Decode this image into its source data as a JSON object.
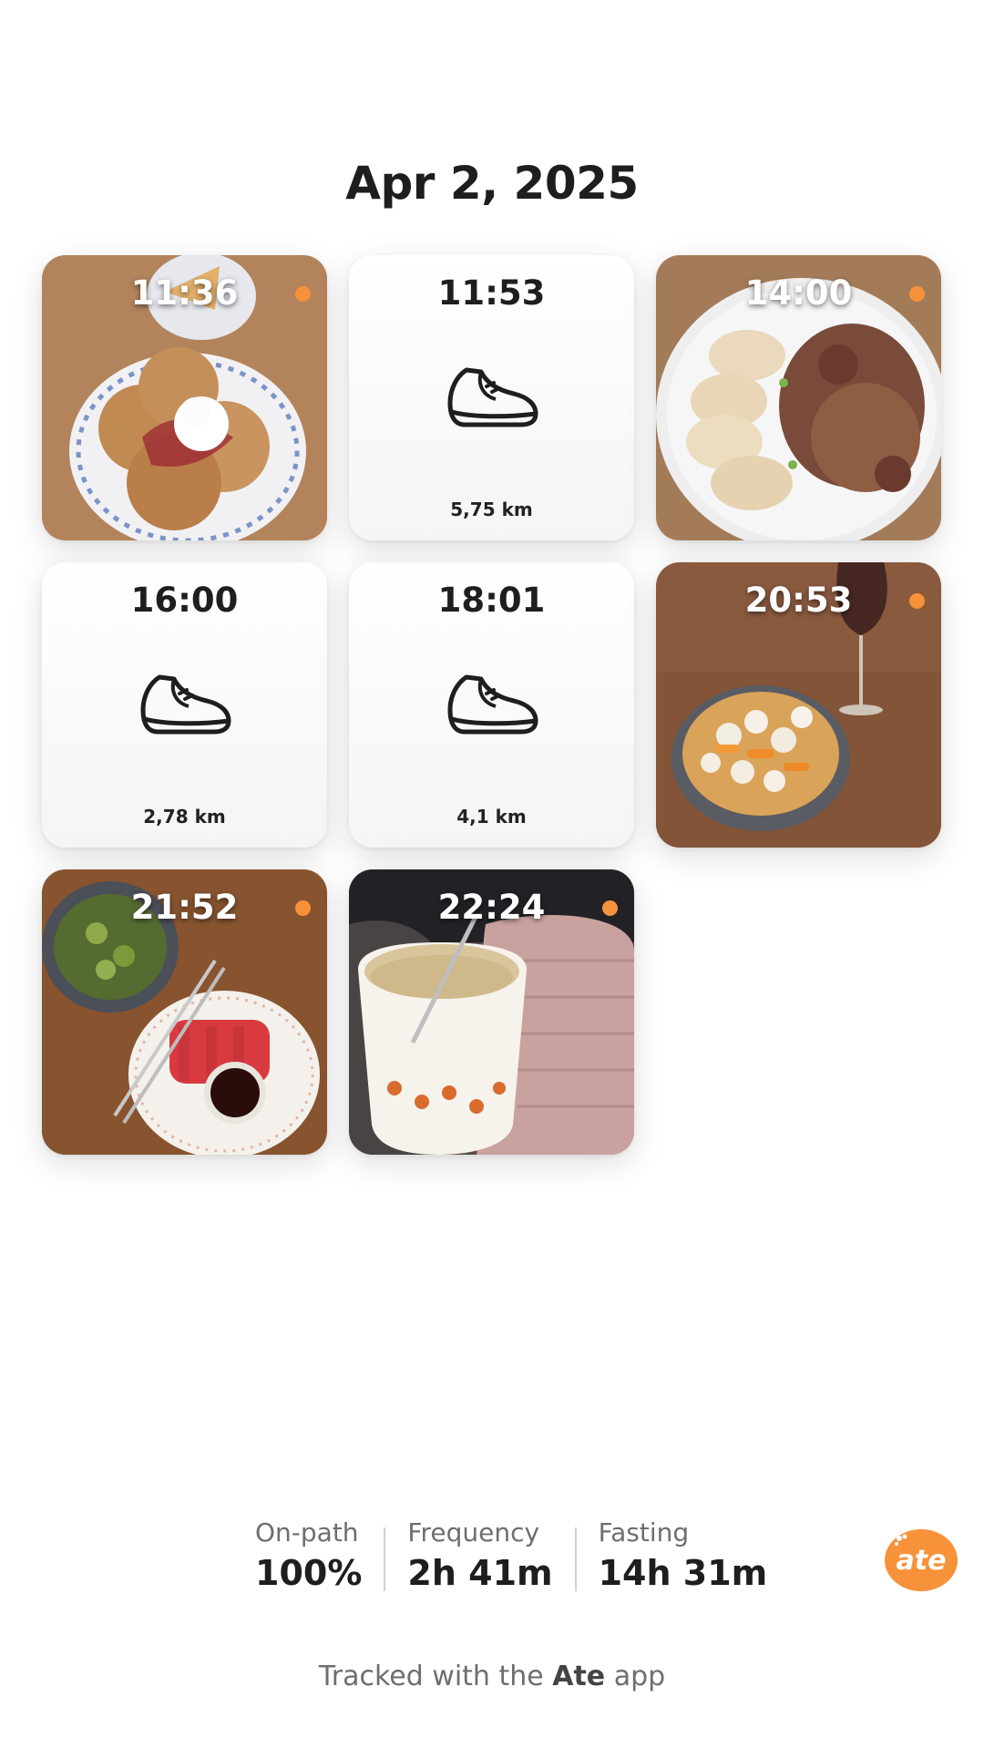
{
  "date": "Apr 2, 2025",
  "entries": [
    {
      "time": "11:36",
      "kind": "photo",
      "icon": "waffles-photo",
      "dot": true
    },
    {
      "time": "11:53",
      "kind": "activity",
      "icon": "sneaker-icon",
      "distance": "5,75 km"
    },
    {
      "time": "14:00",
      "kind": "photo",
      "icon": "dumplings-photo",
      "dot": true
    },
    {
      "time": "16:00",
      "kind": "activity",
      "icon": "sneaker-icon",
      "distance": "2,78 km"
    },
    {
      "time": "18:01",
      "kind": "activity",
      "icon": "sneaker-icon",
      "distance": "4,1 km"
    },
    {
      "time": "20:53",
      "kind": "photo",
      "icon": "popcorn-photo",
      "dot": true
    },
    {
      "time": "21:52",
      "kind": "photo",
      "icon": "sashimi-photo",
      "dot": true
    },
    {
      "time": "22:24",
      "kind": "photo",
      "icon": "drink-cup-photo",
      "dot": true
    }
  ],
  "stats": [
    {
      "label": "On-path",
      "value": "100%"
    },
    {
      "label": "Frequency",
      "value": "2h 41m"
    },
    {
      "label": "Fasting",
      "value": "14h 31m"
    }
  ],
  "logo_text": "ate",
  "footer": {
    "prefix": "Tracked with the",
    "brand": "Ate",
    "suffix": "app"
  },
  "colors": {
    "accent": "#f7923a",
    "text": "#1e1e1e",
    "muted": "#6e6e6e"
  }
}
